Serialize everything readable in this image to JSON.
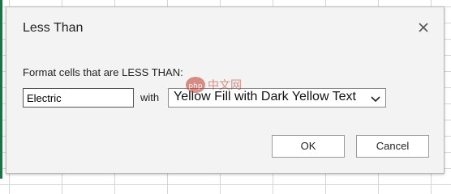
{
  "dialog": {
    "title": "Less Than",
    "prompt": "Format cells that are LESS THAN:",
    "value_input": {
      "value": "Electric"
    },
    "with_label": "with",
    "format_select": {
      "selected": "Yellow Fill with Dark Yellow Text"
    },
    "buttons": {
      "ok": "OK",
      "cancel": "Cancel"
    }
  },
  "watermark": {
    "text": "php中文网"
  },
  "icons": {
    "close": "close-icon",
    "dropdown": "chevron-down-icon"
  },
  "colors": {
    "dialog_bg": "#f3f3f3",
    "sheet_accent": "#1e7145",
    "watermark": "#c0392b"
  }
}
